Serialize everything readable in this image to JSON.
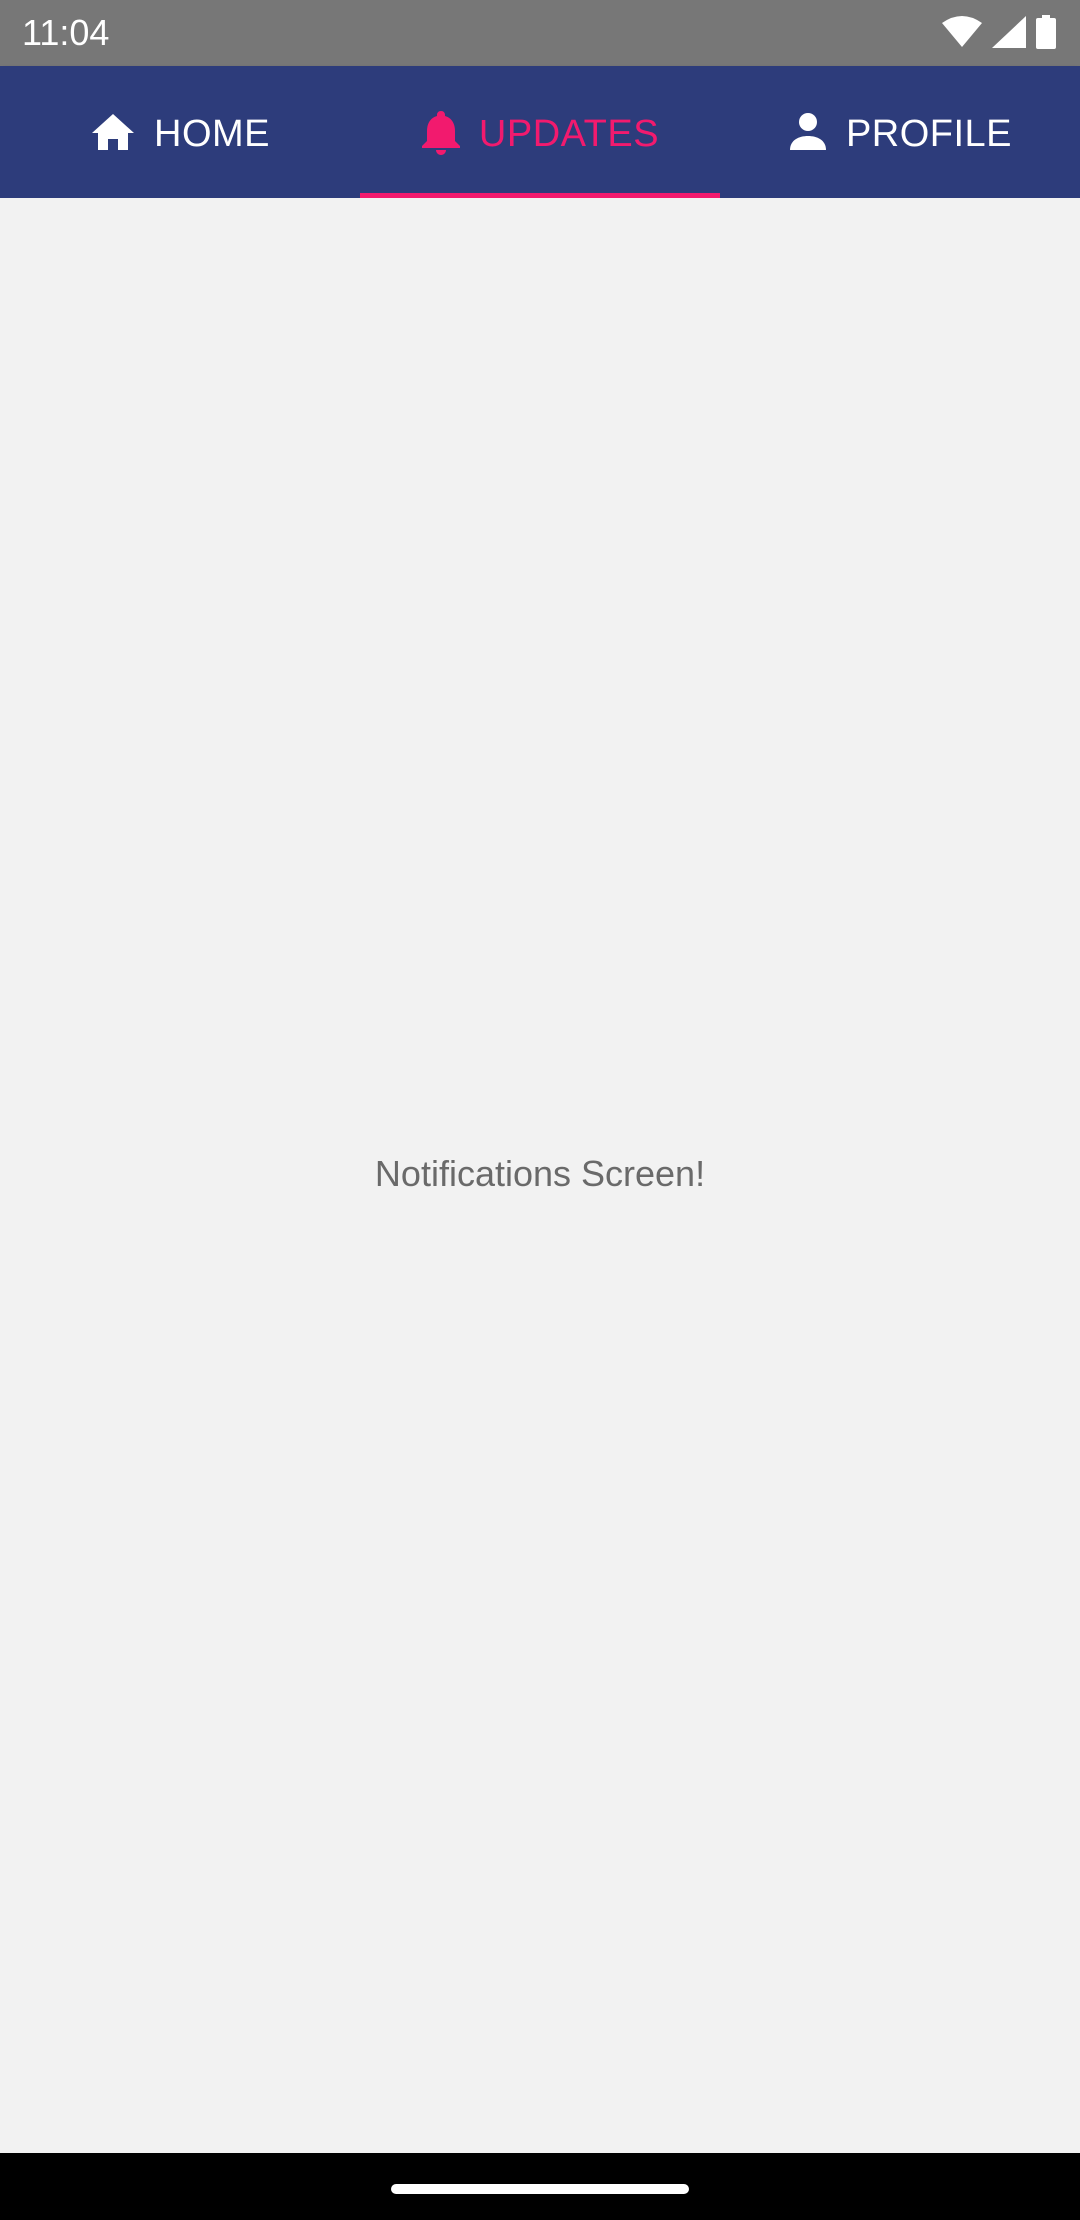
{
  "status_bar": {
    "time": "11:04",
    "icons": [
      "wifi-icon",
      "signal-icon",
      "battery-icon"
    ]
  },
  "tabs": [
    {
      "label": "HOME",
      "icon": "home-icon",
      "active": false
    },
    {
      "label": "UPDATES",
      "icon": "bell-icon",
      "active": true
    },
    {
      "label": "PROFILE",
      "icon": "person-icon",
      "active": false
    }
  ],
  "content": {
    "message": "Notifications Screen!"
  },
  "colors": {
    "tab_bar_bg": "#2d3c7b",
    "accent": "#f21a6e",
    "status_bar_bg": "#777777",
    "content_bg": "#f2f2f2"
  }
}
